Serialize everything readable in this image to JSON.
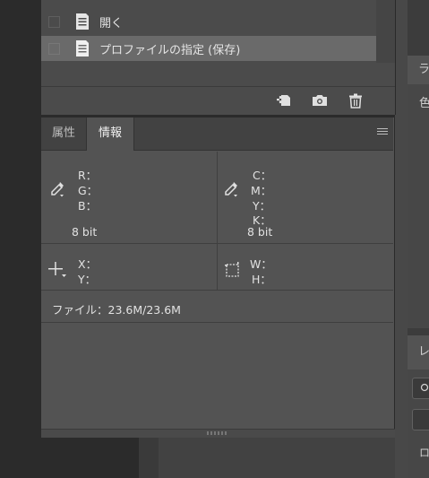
{
  "history_panel": {
    "items": [
      {
        "label": "開く",
        "selected": false
      },
      {
        "label": "プロファイルの指定 (保存)",
        "selected": true
      }
    ],
    "toolbar": {
      "new_document_icon": "new-document-from-state-icon",
      "snapshot_icon": "camera-icon",
      "delete_icon": "trash-icon"
    }
  },
  "info_panel": {
    "tabs": [
      {
        "label": "属性",
        "active": false
      },
      {
        "label": "情報",
        "active": true
      }
    ],
    "rgb": {
      "r": "R：",
      "g": "G：",
      "b": "B：",
      "bitdepth": "8 bit"
    },
    "cmyk": {
      "c": "C：",
      "m": "M：",
      "y": "Y：",
      "k": "K：",
      "bitdepth": "8 bit"
    },
    "position": {
      "x": "X：",
      "y": "Y："
    },
    "size": {
      "w": "W：",
      "h": "H："
    },
    "file_info": "ファイル：23.6M/23.6M"
  },
  "right_dock": {
    "tab1": "ラ",
    "text1": "色",
    "tab2": "レ",
    "text2": "ロッ"
  },
  "colors": {
    "panel_bg": "#535353",
    "selected_row": "#6a6a6a",
    "text": "#e2e2e2"
  }
}
